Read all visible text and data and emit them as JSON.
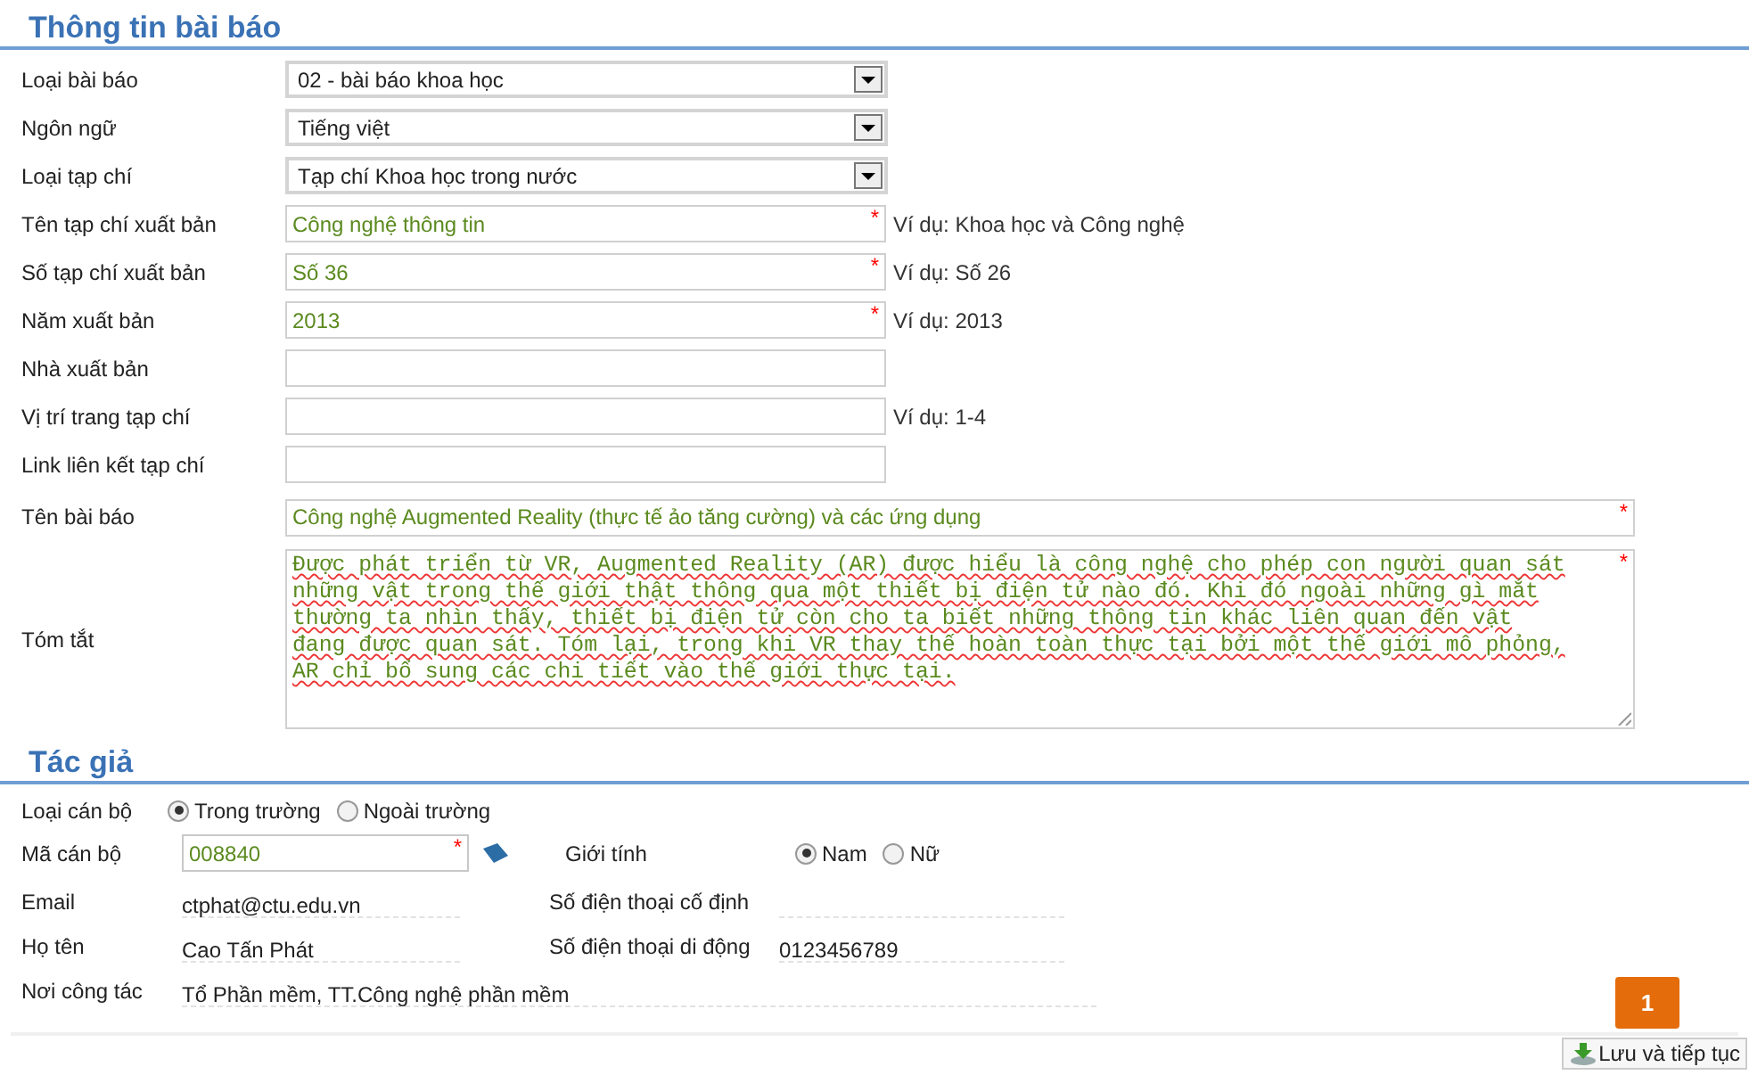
{
  "article": {
    "title": "Thông tin bài báo",
    "fields": [
      {
        "label": "Loại bài báo",
        "kind": "select",
        "value": "02 - bài báo khoa học"
      },
      {
        "label": "Ngôn ngữ",
        "kind": "select",
        "value": "Tiếng việt"
      },
      {
        "label": "Loại tạp chí",
        "kind": "select",
        "value": "Tạp chí Khoa học trong nước"
      },
      {
        "label": "Tên tạp chí xuất bản",
        "kind": "input",
        "value": "Công nghệ thông tin",
        "required": true,
        "hint": "Ví dụ: Khoa học và Công nghệ"
      },
      {
        "label": "Số tạp chí xuất bản",
        "kind": "input",
        "value": "Số 36",
        "required": true,
        "hint": "Ví dụ: Số 26"
      },
      {
        "label": "Năm xuất bản",
        "kind": "input",
        "value": "2013",
        "required": true,
        "hint": "Ví dụ: 2013"
      },
      {
        "label": "Nhà xuất bản",
        "kind": "input",
        "required": false
      },
      {
        "label": "Vị trí trang tạp chí",
        "kind": "input",
        "required": false,
        "hint": "Ví dụ: 1-4"
      },
      {
        "label": "Link liên kết tạp chí",
        "kind": "input",
        "required": false
      },
      {
        "label": "Tên bài báo",
        "kind": "wide",
        "value": "Công nghệ Augmented Reality (thực tế ảo tăng cường) và các ứng dụng",
        "required": true
      },
      {
        "label": "Tóm tắt",
        "kind": "textarea",
        "value": "Được phát triển từ VR, Augmented Reality (AR) được hiểu là công nghệ cho phép con người quan sát những vật trong thế giới thật thông qua một thiết bị điện tử nào đó. Khi đó ngoài những gì mắt thường ta nhìn thấy, thiết bị điện tử còn cho ta biết những thông tin khác liên quan đến vật đang được quan sát. Tóm lại, trong khi VR thay thế hoàn toàn thực tại bởi một thế giới mô phỏng, AR chỉ bổ sung các chi tiết vào thế giới thực tại.",
        "required": true
      }
    ]
  },
  "author": {
    "title": "Tác giả",
    "staff_type": {
      "label": "Loại cán bộ",
      "options": [
        {
          "label": "Trong trường",
          "selected": true
        },
        {
          "label": "Ngoài trường",
          "selected": false
        }
      ]
    },
    "staff_code": {
      "label": "Mã cán bộ",
      "value": "008840",
      "required": true
    },
    "gender": {
      "label": "Giới tính",
      "options": [
        {
          "label": "Nam",
          "selected": true
        },
        {
          "label": "Nữ",
          "selected": false
        }
      ]
    },
    "rows": [
      {
        "left": {
          "label": "Email",
          "value": "ctphat@ctu.edu.vn"
        },
        "right": {
          "label": "Số điện thoại cố định"
        }
      },
      {
        "left": {
          "label": "Họ tên",
          "value": "Cao Tấn Phát"
        },
        "right": {
          "label": "Số điện thoại di động",
          "value": "0123456789"
        }
      },
      {
        "left": {
          "label": "Nơi công tác",
          "value": "Tổ Phần mềm, TT.Công nghệ phần mềm"
        }
      }
    ]
  },
  "required_mark": "*",
  "pager": [
    {
      "label": "1",
      "selected": true
    }
  ],
  "save_button": "Lưu và tiếp tục"
}
